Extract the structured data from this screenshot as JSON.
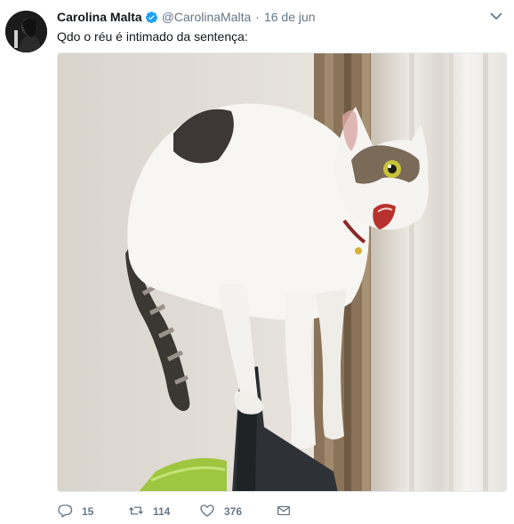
{
  "tweet": {
    "author_name": "Carolina Malta",
    "handle": "@CarolinaMalta",
    "separator": "·",
    "date": "16 de jun",
    "text": "Qdo o réu é intimado da sentença:",
    "verified": true
  },
  "actions": {
    "reply_count": "15",
    "retweet_count": "114",
    "like_count": "376"
  },
  "icons": {
    "reply": "reply-icon",
    "retweet": "retweet-icon",
    "like": "heart-icon",
    "dm": "message-icon",
    "menu": "chevron-down-icon",
    "verified": "verified-badge-icon"
  },
  "colors": {
    "text": "#14171a",
    "secondary": "#657786",
    "verified": "#1da1f2"
  }
}
